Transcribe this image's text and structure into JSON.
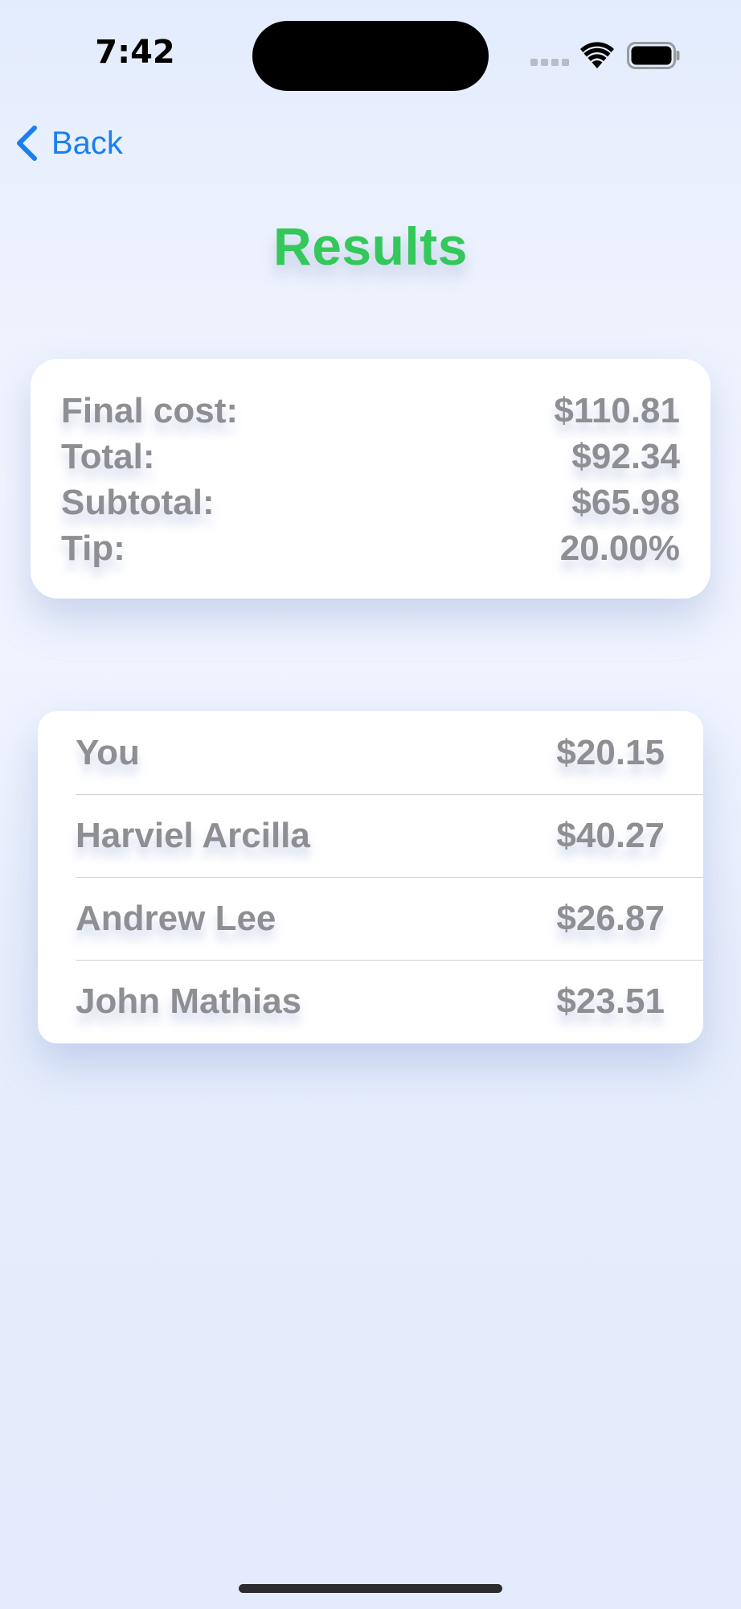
{
  "status_bar": {
    "time": "7:42"
  },
  "nav": {
    "back_label": "Back",
    "back_icon": "chevron-left-icon",
    "accent_color": "#1a7ff0"
  },
  "page": {
    "title": "Results",
    "title_color": "#34c85a"
  },
  "summary": {
    "rows": [
      {
        "label": "Final cost:",
        "value": "$110.81"
      },
      {
        "label": "Total:",
        "value": "$92.34"
      },
      {
        "label": "Subtotal:",
        "value": "$65.98"
      },
      {
        "label": "Tip:",
        "value": "20.00%"
      }
    ]
  },
  "split": {
    "rows": [
      {
        "name": "You",
        "amount": "$20.15"
      },
      {
        "name": "Harviel Arcilla",
        "amount": "$40.27"
      },
      {
        "name": "Andrew Lee",
        "amount": "$26.87"
      },
      {
        "name": "John Mathias",
        "amount": "$23.51"
      }
    ]
  }
}
